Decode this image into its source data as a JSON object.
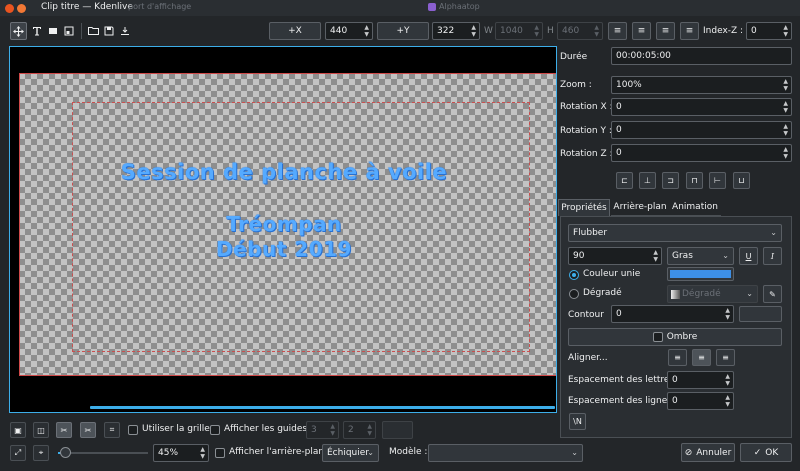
{
  "window": {
    "title": "Clip titre — Kdenlive",
    "ghost_left": "port d'affichage",
    "ghost_right": "Alphaatop"
  },
  "toolbar": {
    "plus_x_label": "+X",
    "x_value": "440",
    "plus_y_label": "+Y",
    "y_value": "322",
    "w_label": "W",
    "w_value": "1040",
    "h_label": "H",
    "h_value": "460",
    "z_index_label": "Index-Z :",
    "z_index_value": "0"
  },
  "title_text": {
    "line1": "Session de planche à voile",
    "line2": "Tréompan",
    "line3": "Début 2019",
    "color": "#55aaff"
  },
  "properties": {
    "duration_label": "Durée",
    "duration_value": "00:00:05:00",
    "zoom_label": "Zoom :",
    "zoom_value": "100%",
    "rotation_x_label": "Rotation X :",
    "rotation_x_value": "0",
    "rotation_y_label": "Rotation Y :",
    "rotation_y_value": "0",
    "rotation_z_label": "Rotation Z :",
    "rotation_z_value": "0"
  },
  "tabs": {
    "properties": "Propriétés",
    "background": "Arrière-plan",
    "animation": "Animation"
  },
  "text_props": {
    "font": "Flubber",
    "size": "90",
    "weight": "Gras",
    "bold_label": "U",
    "italic_label": "I",
    "solid_color_label": "Couleur unie",
    "solid_color": "#3d8fe6",
    "gradient_label": "Dégradé",
    "gradient_value": "Dégradé",
    "outline_label": "Contour",
    "outline_value": "0",
    "shadow_label": "Ombre",
    "align_label": "Aligner...",
    "letter_spacing_label": "Espacement des lettres",
    "letter_spacing_value": "0",
    "line_spacing_label": "Espacement des lignes",
    "line_spacing_value": "0",
    "wrap_label": "\\N"
  },
  "bottom": {
    "use_grid_label": "Utiliser la grille",
    "show_guides_label": "Afficher les guides",
    "guide_h_value": "3",
    "guide_v_value": "2",
    "zoom_value": "45%",
    "show_bg_label": "Afficher l'arrière-plan",
    "bg_value": "Échiquier",
    "model_label": "Modèle :",
    "model_value": "",
    "cancel_label": "Annuler",
    "ok_label": "OK"
  },
  "icons": {
    "select": "move-icon",
    "text": "text-tool-icon",
    "rect": "rectangle-tool-icon",
    "image": "image-tool-icon",
    "open": "folder-open-icon",
    "save": "save-icon",
    "export": "download-icon"
  }
}
